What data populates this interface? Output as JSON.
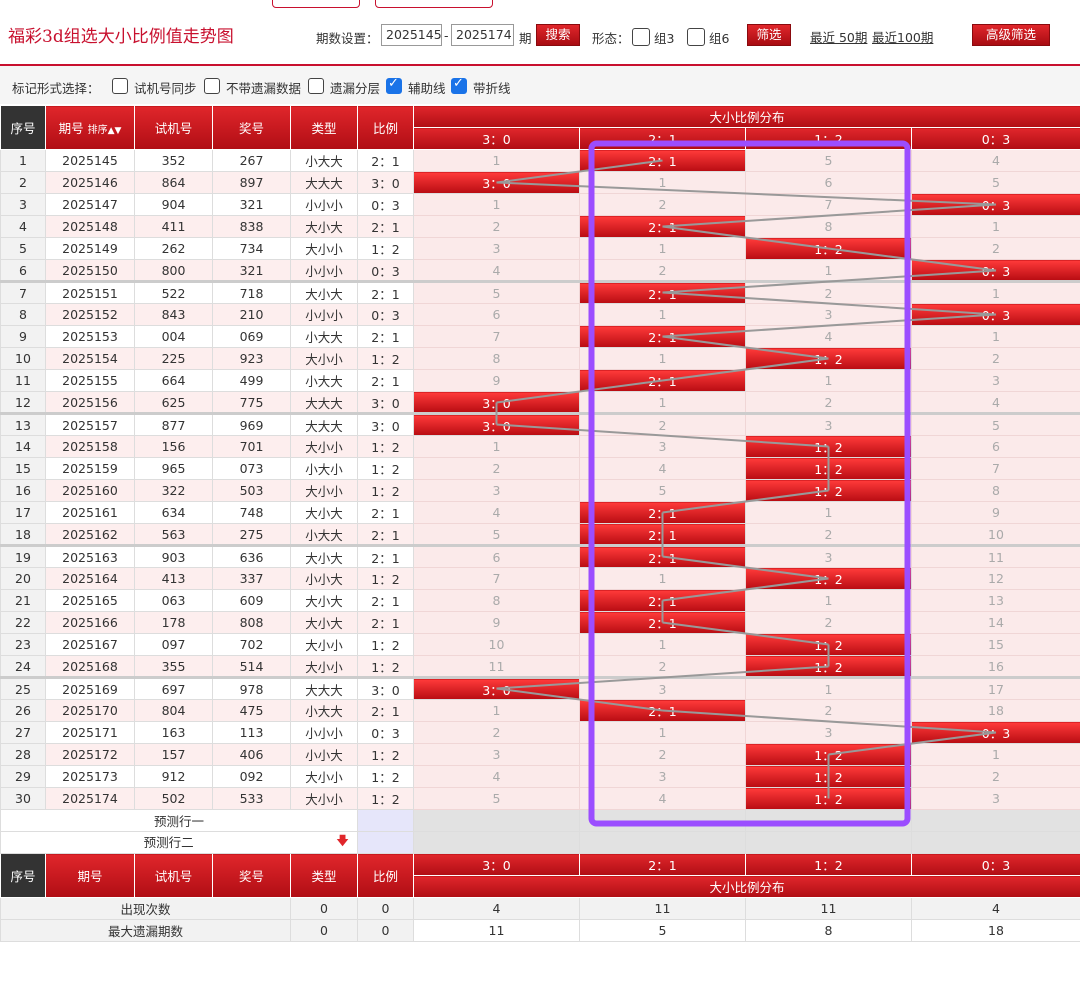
{
  "header": {
    "title": "福彩3d组选大小比例值走势图",
    "period_label": "期数设置：",
    "period_start": "2025145",
    "period_dash": "-",
    "period_end": "2025174",
    "period_unit": "期",
    "search_btn": "搜索",
    "shape_label": "形态：",
    "group3": "组3",
    "group6": "组6",
    "filter_btn": "筛选",
    "recent50": "最近 50期",
    "recent100": "最近100期",
    "adv_filter": "高级筛选"
  },
  "markbar": {
    "label": "标记形式选择：",
    "opts": [
      {
        "label": "试机号同步",
        "checked": false
      },
      {
        "label": "不带遗漏数据",
        "checked": false
      },
      {
        "label": "遗漏分层",
        "checked": false
      },
      {
        "label": "辅助线",
        "checked": true
      },
      {
        "label": "带折线",
        "checked": true
      }
    ]
  },
  "table": {
    "h_seq": "序号",
    "h_issue": "期号",
    "h_sort": "排序",
    "h_trial": "试机号",
    "h_prize": "奖号",
    "h_type": "类型",
    "h_ratio": "比例",
    "h_dist": "大小比例分布",
    "ratio_cols": [
      "3：0",
      "2：1",
      "1：2",
      "0：3"
    ],
    "rows": [
      {
        "seq": "1",
        "issue": "2025145",
        "trial": "352",
        "prize": "267",
        "type": "小大大",
        "ratio": "2：1",
        "d": [
          "1",
          "2：1",
          "5",
          "4"
        ],
        "hit": 1
      },
      {
        "seq": "2",
        "issue": "2025146",
        "trial": "864",
        "prize": "897",
        "type": "大大大",
        "ratio": "3：0",
        "d": [
          "3：0",
          "1",
          "6",
          "5"
        ],
        "hit": 0
      },
      {
        "seq": "3",
        "issue": "2025147",
        "trial": "904",
        "prize": "321",
        "type": "小小小",
        "ratio": "0：3",
        "d": [
          "1",
          "2",
          "7",
          "0：3"
        ],
        "hit": 3
      },
      {
        "seq": "4",
        "issue": "2025148",
        "trial": "411",
        "prize": "838",
        "type": "大小大",
        "ratio": "2：1",
        "d": [
          "2",
          "2：1",
          "8",
          "1"
        ],
        "hit": 1
      },
      {
        "seq": "5",
        "issue": "2025149",
        "trial": "262",
        "prize": "734",
        "type": "大小小",
        "ratio": "1：2",
        "d": [
          "3",
          "1",
          "1：2",
          "2"
        ],
        "hit": 2
      },
      {
        "seq": "6",
        "issue": "2025150",
        "trial": "800",
        "prize": "321",
        "type": "小小小",
        "ratio": "0：3",
        "d": [
          "4",
          "2",
          "1",
          "0：3"
        ],
        "hit": 3
      },
      {
        "seq": "7",
        "issue": "2025151",
        "trial": "522",
        "prize": "718",
        "type": "大小大",
        "ratio": "2：1",
        "d": [
          "5",
          "2：1",
          "2",
          "1"
        ],
        "hit": 1
      },
      {
        "seq": "8",
        "issue": "2025152",
        "trial": "843",
        "prize": "210",
        "type": "小小小",
        "ratio": "0：3",
        "d": [
          "6",
          "1",
          "3",
          "0：3"
        ],
        "hit": 3
      },
      {
        "seq": "9",
        "issue": "2025153",
        "trial": "004",
        "prize": "069",
        "type": "小大大",
        "ratio": "2：1",
        "d": [
          "7",
          "2：1",
          "4",
          "1"
        ],
        "hit": 1
      },
      {
        "seq": "10",
        "issue": "2025154",
        "trial": "225",
        "prize": "923",
        "type": "大小小",
        "ratio": "1：2",
        "d": [
          "8",
          "1",
          "1：2",
          "2"
        ],
        "hit": 2
      },
      {
        "seq": "11",
        "issue": "2025155",
        "trial": "664",
        "prize": "499",
        "type": "小大大",
        "ratio": "2：1",
        "d": [
          "9",
          "2：1",
          "1",
          "3"
        ],
        "hit": 1
      },
      {
        "seq": "12",
        "issue": "2025156",
        "trial": "625",
        "prize": "775",
        "type": "大大大",
        "ratio": "3：0",
        "d": [
          "3：0",
          "1",
          "2",
          "4"
        ],
        "hit": 0
      },
      {
        "seq": "13",
        "issue": "2025157",
        "trial": "877",
        "prize": "969",
        "type": "大大大",
        "ratio": "3：0",
        "d": [
          "3：0",
          "2",
          "3",
          "5"
        ],
        "hit": 0
      },
      {
        "seq": "14",
        "issue": "2025158",
        "trial": "156",
        "prize": "701",
        "type": "大小小",
        "ratio": "1：2",
        "d": [
          "1",
          "3",
          "1：2",
          "6"
        ],
        "hit": 2
      },
      {
        "seq": "15",
        "issue": "2025159",
        "trial": "965",
        "prize": "073",
        "type": "小大小",
        "ratio": "1：2",
        "d": [
          "2",
          "4",
          "1：2",
          "7"
        ],
        "hit": 2
      },
      {
        "seq": "16",
        "issue": "2025160",
        "trial": "322",
        "prize": "503",
        "type": "大小小",
        "ratio": "1：2",
        "d": [
          "3",
          "5",
          "1：2",
          "8"
        ],
        "hit": 2
      },
      {
        "seq": "17",
        "issue": "2025161",
        "trial": "634",
        "prize": "748",
        "type": "大小大",
        "ratio": "2：1",
        "d": [
          "4",
          "2：1",
          "1",
          "9"
        ],
        "hit": 1
      },
      {
        "seq": "18",
        "issue": "2025162",
        "trial": "563",
        "prize": "275",
        "type": "小大大",
        "ratio": "2：1",
        "d": [
          "5",
          "2：1",
          "2",
          "10"
        ],
        "hit": 1
      },
      {
        "seq": "19",
        "issue": "2025163",
        "trial": "903",
        "prize": "636",
        "type": "大小大",
        "ratio": "2：1",
        "d": [
          "6",
          "2：1",
          "3",
          "11"
        ],
        "hit": 1
      },
      {
        "seq": "20",
        "issue": "2025164",
        "trial": "413",
        "prize": "337",
        "type": "小小大",
        "ratio": "1：2",
        "d": [
          "7",
          "1",
          "1：2",
          "12"
        ],
        "hit": 2
      },
      {
        "seq": "21",
        "issue": "2025165",
        "trial": "063",
        "prize": "609",
        "type": "大小大",
        "ratio": "2：1",
        "d": [
          "8",
          "2：1",
          "1",
          "13"
        ],
        "hit": 1
      },
      {
        "seq": "22",
        "issue": "2025166",
        "trial": "178",
        "prize": "808",
        "type": "大小大",
        "ratio": "2：1",
        "d": [
          "9",
          "2：1",
          "2",
          "14"
        ],
        "hit": 1
      },
      {
        "seq": "23",
        "issue": "2025167",
        "trial": "097",
        "prize": "702",
        "type": "大小小",
        "ratio": "1：2",
        "d": [
          "10",
          "1",
          "1：2",
          "15"
        ],
        "hit": 2
      },
      {
        "seq": "24",
        "issue": "2025168",
        "trial": "355",
        "prize": "514",
        "type": "大小小",
        "ratio": "1：2",
        "d": [
          "11",
          "2",
          "1：2",
          "16"
        ],
        "hit": 2
      },
      {
        "seq": "25",
        "issue": "2025169",
        "trial": "697",
        "prize": "978",
        "type": "大大大",
        "ratio": "3：0",
        "d": [
          "3：0",
          "3",
          "1",
          "17"
        ],
        "hit": 0
      },
      {
        "seq": "26",
        "issue": "2025170",
        "trial": "804",
        "prize": "475",
        "type": "小大大",
        "ratio": "2：1",
        "d": [
          "1",
          "2：1",
          "2",
          "18"
        ],
        "hit": 1
      },
      {
        "seq": "27",
        "issue": "2025171",
        "trial": "163",
        "prize": "113",
        "type": "小小小",
        "ratio": "0：3",
        "d": [
          "2",
          "1",
          "3",
          "0：3"
        ],
        "hit": 3
      },
      {
        "seq": "28",
        "issue": "2025172",
        "trial": "157",
        "prize": "406",
        "type": "小小大",
        "ratio": "1：2",
        "d": [
          "3",
          "2",
          "1：2",
          "1"
        ],
        "hit": 2
      },
      {
        "seq": "29",
        "issue": "2025173",
        "trial": "912",
        "prize": "092",
        "type": "大小小",
        "ratio": "1：2",
        "d": [
          "4",
          "3",
          "1：2",
          "2"
        ],
        "hit": 2
      },
      {
        "seq": "30",
        "issue": "2025174",
        "trial": "502",
        "prize": "533",
        "type": "大小小",
        "ratio": "1：2",
        "d": [
          "5",
          "4",
          "1：2",
          "3"
        ],
        "hit": 2
      }
    ],
    "predict1": "预测行一",
    "predict2": "预测行二",
    "stats": [
      {
        "label": "出现次数",
        "a": "0",
        "b": "0",
        "d": [
          "4",
          "11",
          "11",
          "4"
        ]
      },
      {
        "label": "最大遗漏期数",
        "a": "0",
        "b": "0",
        "d": [
          "11",
          "5",
          "8",
          "18"
        ]
      }
    ]
  },
  "colors": {
    "accent": "#c8102e",
    "highlight_box": "#9b4dff",
    "trend_line": "#999999",
    "checkbox_on": "#1a73e8"
  }
}
